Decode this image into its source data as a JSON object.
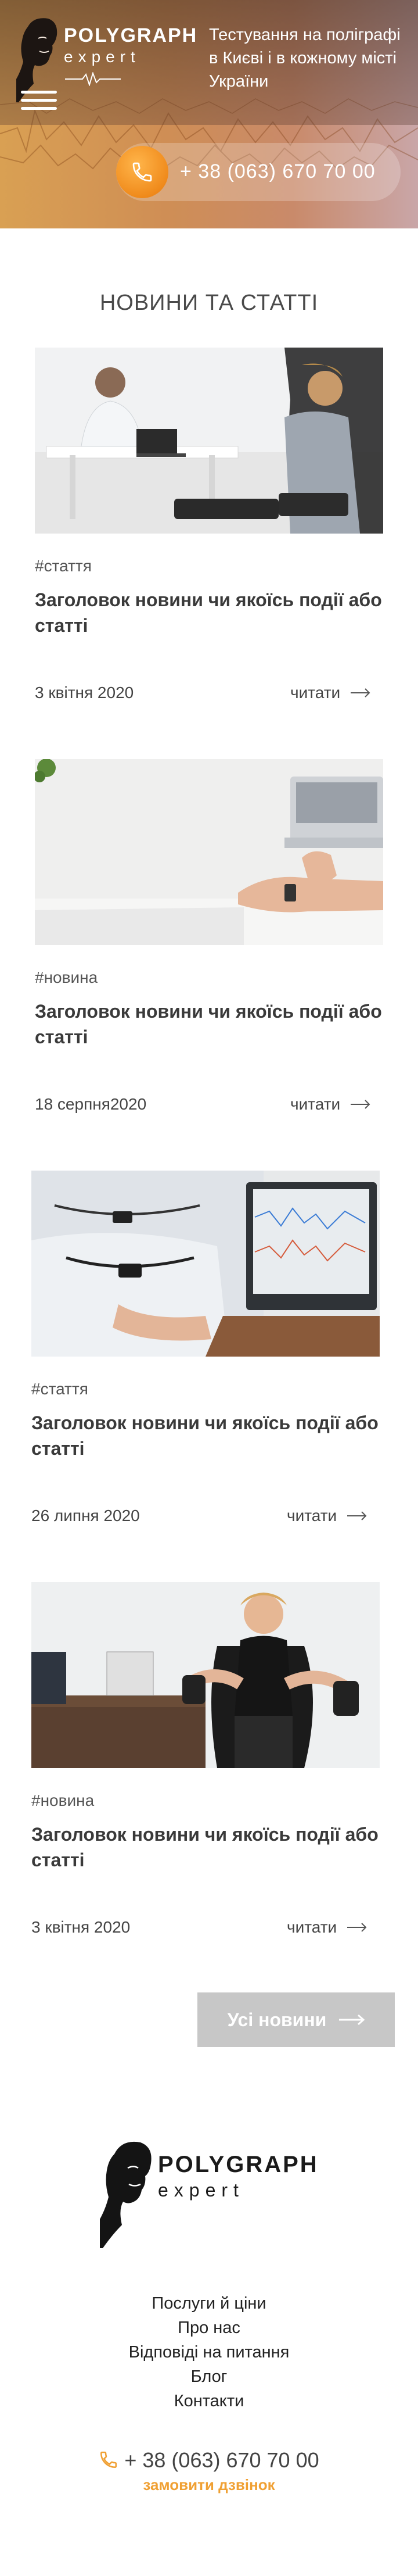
{
  "header": {
    "brand": "POLYGRAPH",
    "brand_sub": "expert",
    "tagline": "Тестування на поліграфі в Києві і в кожному місті України",
    "phone": "+ 38 (063) 670 70 00",
    "icons": {
      "menu": "burger-menu-icon",
      "phone": "phone-icon"
    },
    "colors": {
      "accent": "#f08b1c"
    }
  },
  "news": {
    "title": "НОВИНИ ТА СТАТТІ",
    "read_label": "читати",
    "items": [
      {
        "tag": "#стаття",
        "title": "Заголовок новини чи якоїсь події або статті",
        "date": "3 квітня 2020"
      },
      {
        "tag": "#новина",
        "title": "Заголовок новини чи якоїсь події або статті",
        "date": "18 серпня2020"
      },
      {
        "tag": "#стаття",
        "title": "Заголовок новини чи якоїсь події або статті",
        "date": "26 липня 2020"
      },
      {
        "tag": "#новина",
        "title": "Заголовок новини чи якоїсь події або статті",
        "date": "3 квітня 2020"
      }
    ],
    "all_label": "Усі новини"
  },
  "footer": {
    "brand": "POLYGRAPH",
    "brand_sub": "expert",
    "nav": [
      "Послуги й ціни",
      "Про нас",
      "Відповіді на питання",
      "Блог",
      "Контакти"
    ],
    "phone": "+ 38 (063) 670 70 00",
    "callback": "замовити дзвінок",
    "colors": {
      "callback": "#f0a033"
    }
  }
}
